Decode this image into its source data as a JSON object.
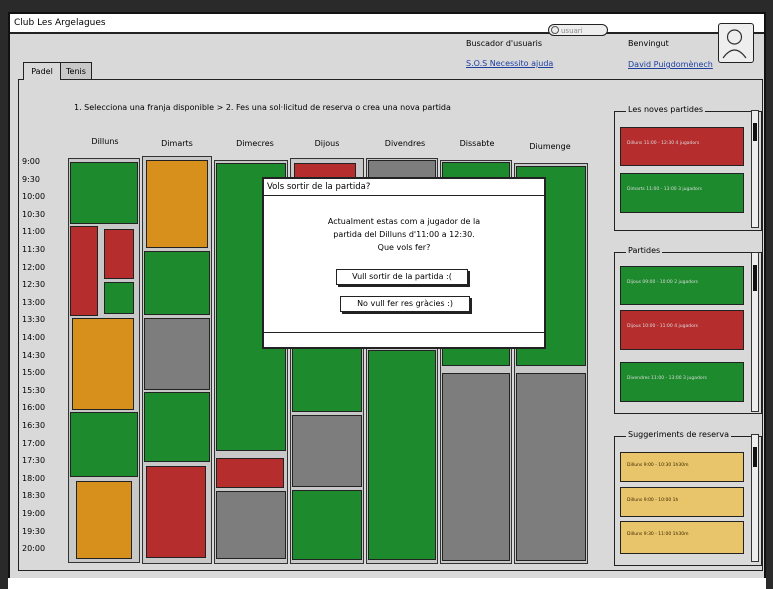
{
  "app_title": "Club Les Argelagues",
  "header": {
    "search_label": "Buscador d'usuaris",
    "search_placeholder": "usuari",
    "help_link": "S.O.S Necessito ajuda",
    "welcome": "Benvingut",
    "user_name": "David Puigdomènech"
  },
  "tabs": [
    {
      "label": "Padel"
    },
    {
      "label": "Tenis"
    }
  ],
  "instructions": "1. Selecciona una franja disponible > 2. Fes una sol·licitud de reserva o crea una nova partida",
  "days": [
    "Dilluns",
    "Dimarts",
    "Dimecres",
    "Dijous",
    "Divendres",
    "Dissabte",
    "Diumenge"
  ],
  "times": [
    "9:00",
    "9:30",
    "10:00",
    "10:30",
    "11:00",
    "11:30",
    "12:00",
    "12:30",
    "13:00",
    "13:30",
    "14:00",
    "14:30",
    "15:00",
    "15:30",
    "16:00",
    "16:30",
    "17:00",
    "17:30",
    "18:00",
    "18:30",
    "19:00",
    "19:30",
    "20:00"
  ],
  "sidebar": {
    "new_games_title": "Les noves partides",
    "new_games": [
      "Dilluns 11:00 - 12:30 4 jugadors",
      "Dimarts 11:00 - 13:00 3 jugadors"
    ],
    "games_title": "Partides",
    "games": [
      "Dijous 09:00 - 10:00 2 jugadors",
      "Dijous 10:00 - 11:00 4 jugadors",
      "Divendres 11:00 - 13:00 3 jugadors"
    ],
    "suggestions_title": "Suggeriments de reserva",
    "suggestions": [
      "Dilluns 9:00 - 10:30 1h30m",
      "Dilluns 9:00 - 10:00 1h",
      "Dilluns 9:30 - 11:00 1h30m"
    ]
  },
  "modal": {
    "title": "Vols sortir de la partida?",
    "line1": "Actualment estas com a jugador de la",
    "line2": "partida del Dilluns d'11:00 a 12:30.",
    "line3": "Que vols fer?",
    "leave_button": "Vull sortir de la partida :(",
    "stay_button": "No vull fer res gràcies :)"
  },
  "colors": {
    "available": "#1e8a2e",
    "full": "#b62d2d",
    "partial": "#d7901b",
    "unavailable": "#7d7d7d",
    "suggestion": "#e8c46a"
  }
}
